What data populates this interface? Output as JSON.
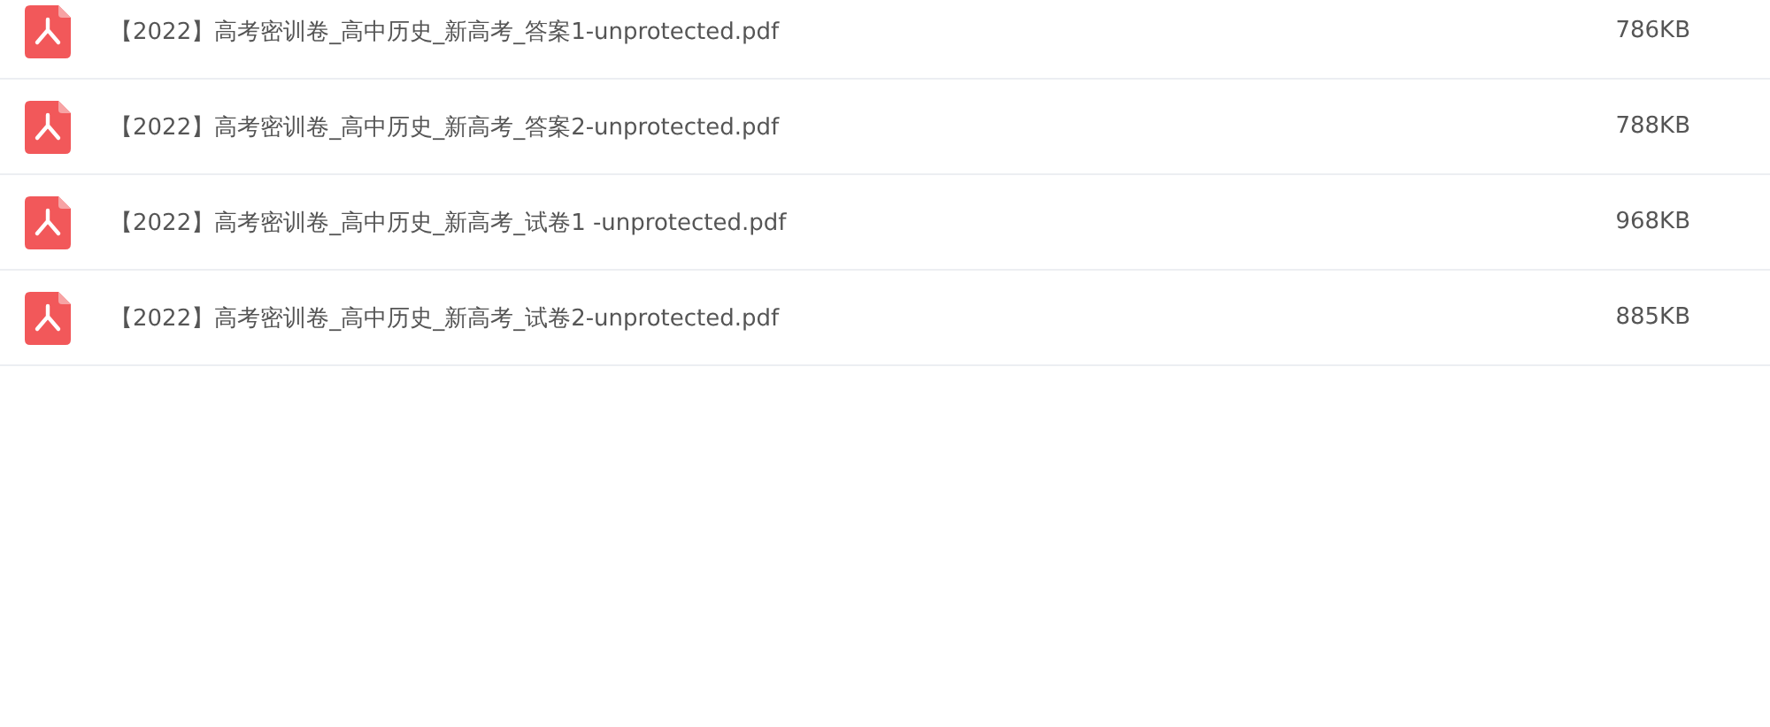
{
  "files": [
    {
      "name": "【2022】高考密训卷_高中历史_新高考_答案1-unprotected.pdf",
      "size": "786KB"
    },
    {
      "name": "【2022】高考密训卷_高中历史_新高考_答案2-unprotected.pdf",
      "size": "788KB"
    },
    {
      "name": "【2022】高考密训卷_高中历史_新高考_试卷1 -unprotected.pdf",
      "size": "968KB"
    },
    {
      "name": "【2022】高考密训卷_高中历史_新高考_试卷2-unprotected.pdf",
      "size": "885KB"
    }
  ]
}
